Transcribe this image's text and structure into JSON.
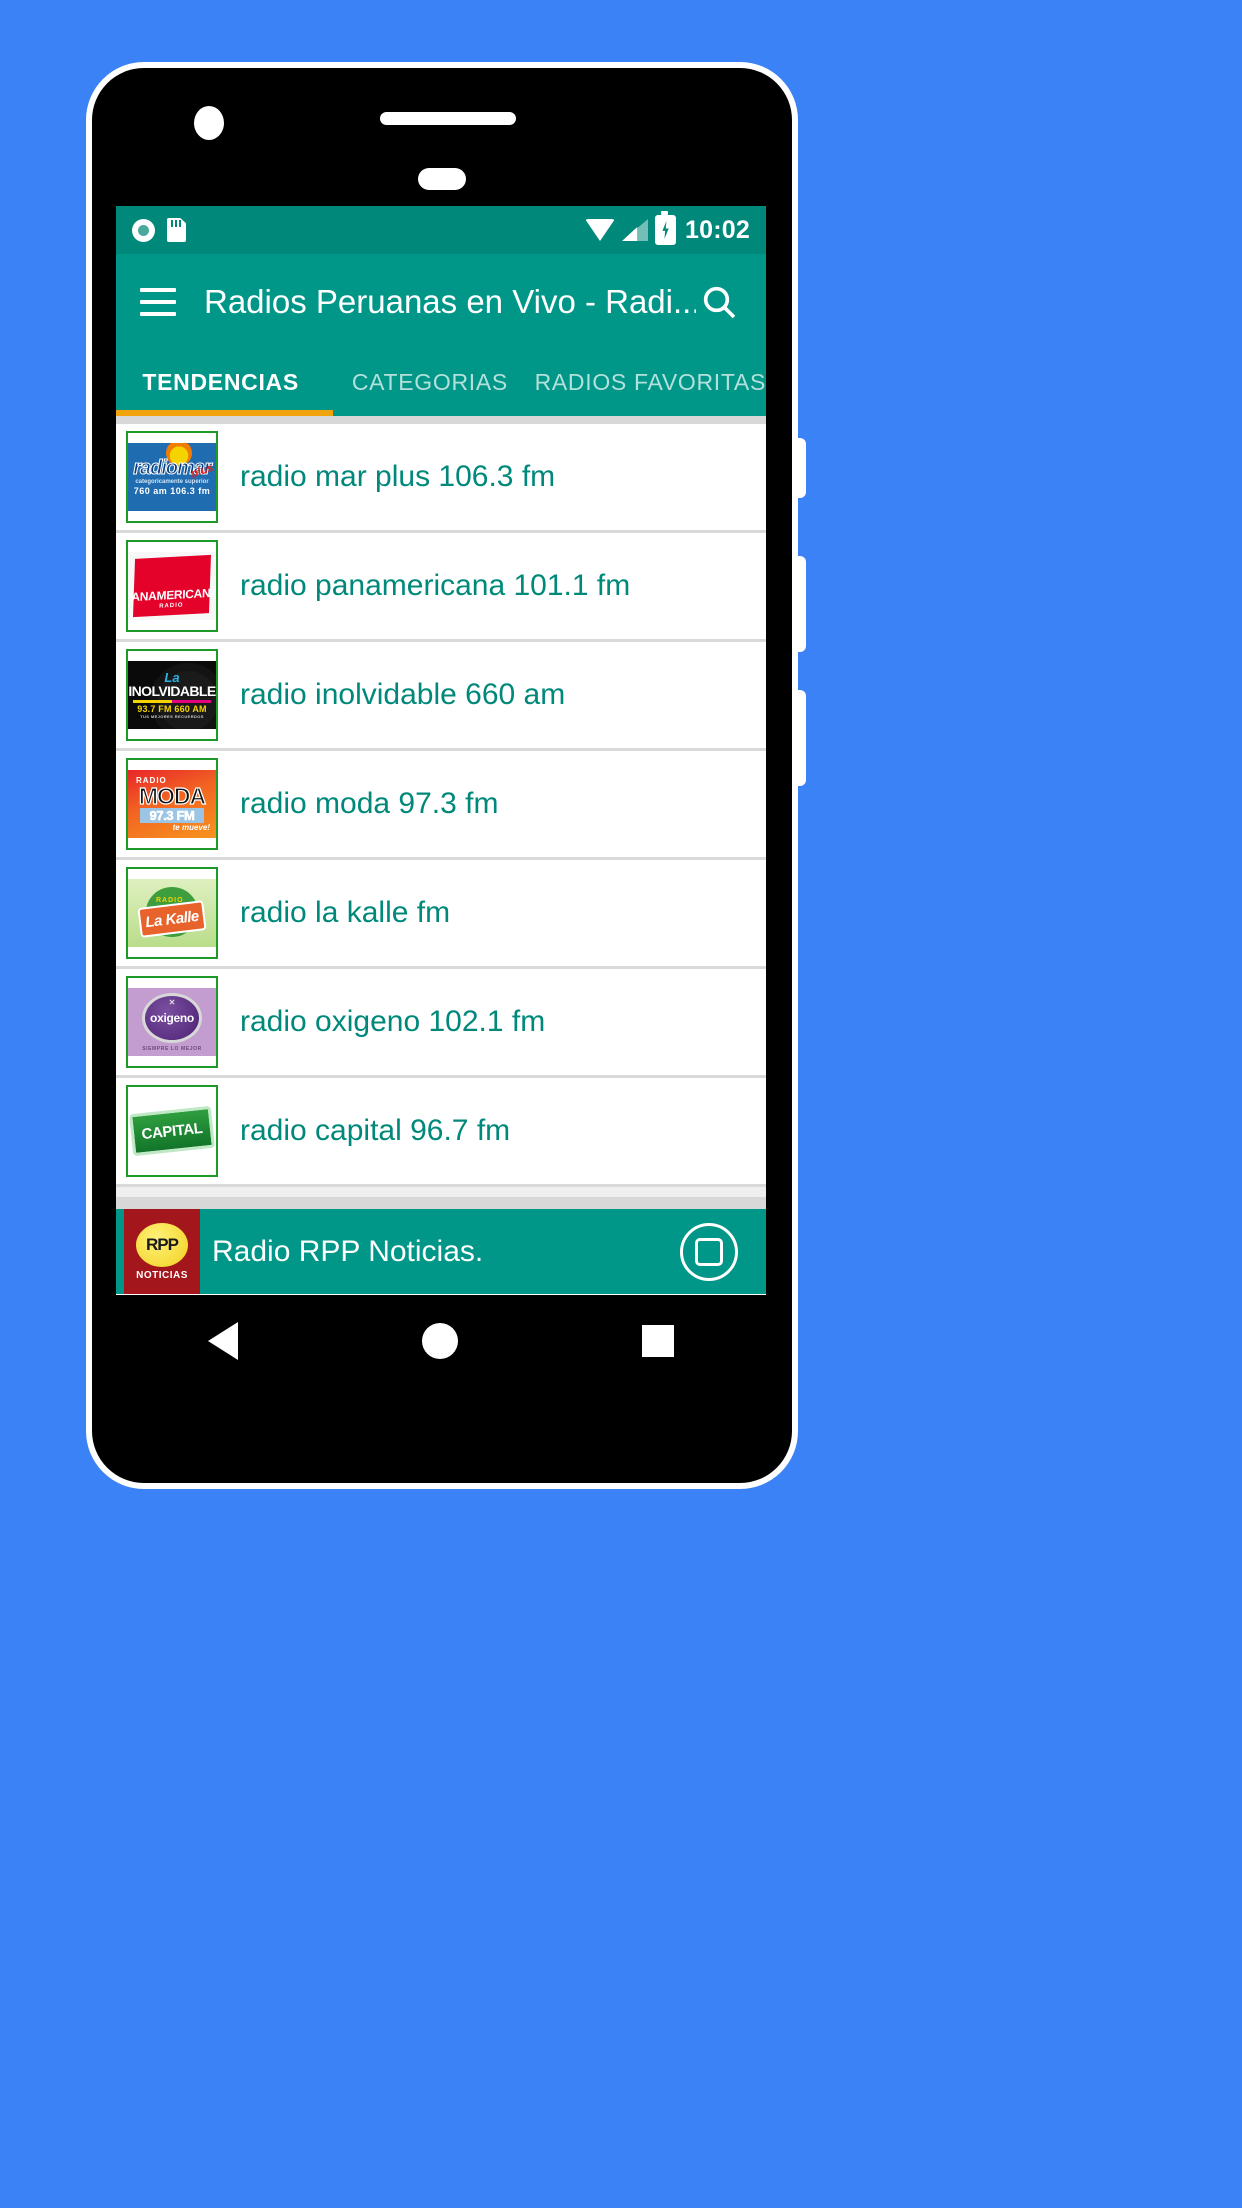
{
  "status_bar": {
    "icons": [
      "disc-icon",
      "sd-card-icon",
      "wifi-icon",
      "cellular-signal-icon",
      "battery-charging-icon"
    ],
    "clock": "10:02"
  },
  "app_bar": {
    "menu_icon": "hamburger-menu-icon",
    "title": "Radios Peruanas en Vivo - Radi...",
    "search_icon": "search-icon"
  },
  "tabs": {
    "items": [
      {
        "label": "TENDENCIAS",
        "active": true
      },
      {
        "label": "CATEGORIAS",
        "active": false
      },
      {
        "label": "RADIOS FAVORITAS",
        "active": false
      }
    ],
    "indicator_color": "#f0a30a"
  },
  "stations": [
    {
      "name": "radio mar plus 106.3 fm",
      "logo": "radiomar-plus-logo",
      "logo_text": {
        "main": "radiomar",
        "tagline": "categoricamente superior",
        "freq": "760 am     106.3 fm",
        "badge": "plus"
      }
    },
    {
      "name": "radio panamericana  101.1 fm",
      "logo": "panamericana-logo",
      "logo_text": {
        "main": "PANAMERICANA",
        "sub": "RADIO"
      }
    },
    {
      "name": "radio inolvidable 660 am",
      "logo": "la-inolvidable-logo",
      "logo_text": {
        "la": "La",
        "main": "INOLVIDABLE",
        "freq": "93.7 FM  660 AM",
        "sub": "TUS MEJORES RECUERDOS"
      }
    },
    {
      "name": "radio moda 97.3 fm",
      "logo": "radio-moda-logo",
      "logo_text": {
        "radio": "RADIO",
        "main": "MODA",
        "freq": "97.3 FM",
        "tagline": "te mueve!"
      }
    },
    {
      "name": "radio la kalle fm",
      "logo": "la-kalle-logo",
      "logo_text": {
        "radio": "RADIO",
        "main": "La Kalle"
      }
    },
    {
      "name": "radio oxigeno 102.1 fm",
      "logo": "oxigeno-logo",
      "logo_text": {
        "main": "oxigeno",
        "sub": "SIEMPRE LO MEJOR"
      }
    },
    {
      "name": "radio capital 96.7 fm",
      "logo": "radio-capital-logo",
      "logo_text": {
        "main": "CAPITAL"
      }
    }
  ],
  "player": {
    "logo": "rpp-noticias-logo",
    "logo_text": {
      "main": "RPP",
      "sub": "NOTICIAS"
    },
    "title": "Radio RPP Noticias.",
    "stop_icon": "stop-button-icon"
  },
  "nav_bar": {
    "back": "back-triangle-icon",
    "home": "home-circle-icon",
    "recents": "recents-square-icon"
  },
  "colors": {
    "primary": "#009688",
    "status_bar": "#00897a",
    "accent": "#f0a30a",
    "text_teal": "#00897a",
    "logo_border_green": "#1d9a27",
    "page_background": "#3b82f6"
  }
}
